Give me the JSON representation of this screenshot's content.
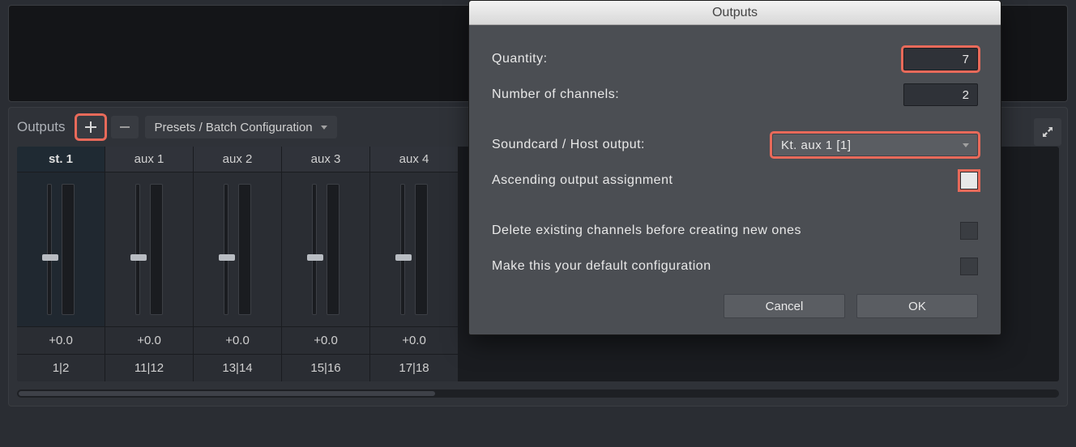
{
  "panel": {
    "title": "Outputs",
    "presets_label": "Presets / Batch Configuration"
  },
  "channels": [
    {
      "name": "st. 1",
      "gain": "+0.0",
      "routing": "1|2",
      "active": true
    },
    {
      "name": "aux 1",
      "gain": "+0.0",
      "routing": "11|12",
      "active": false
    },
    {
      "name": "aux 2",
      "gain": "+0.0",
      "routing": "13|14",
      "active": false
    },
    {
      "name": "aux 3",
      "gain": "+0.0",
      "routing": "15|16",
      "active": false
    },
    {
      "name": "aux 4",
      "gain": "+0.0",
      "routing": "17|18",
      "active": false
    }
  ],
  "dialog": {
    "title": "Outputs",
    "quantity_label": "Quantity:",
    "quantity_value": "7",
    "channels_label": "Number of channels:",
    "channels_value": "2",
    "host_label": "Soundcard / Host output:",
    "host_value": "Kt. aux 1 [1]",
    "ascending_label": "Ascending output assignment",
    "delete_label": "Delete existing channels before creating new ones",
    "default_label": "Make this your default configuration",
    "cancel": "Cancel",
    "ok": "OK"
  }
}
